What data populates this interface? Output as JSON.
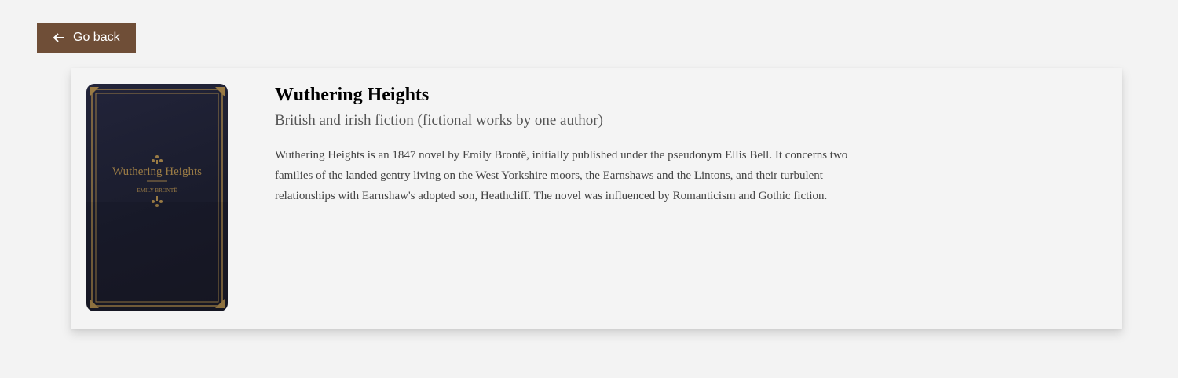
{
  "nav": {
    "back_label": "Go back",
    "back_icon": "arrow-left-icon",
    "accent_color": "#6f4e37"
  },
  "book": {
    "title": "Wuthering Heights",
    "category": "British and irish fiction (fictional works by one author)",
    "description": "Wuthering Heights is an 1847 novel by Emily Brontë, initially published under the pseudonym Ellis Bell. It concerns two families of the landed gentry living on the West Yorkshire moors, the Earnshaws and the Lintons, and their turbulent relationships with Earnshaw's adopted son, Heathcliff. The novel was influenced by Romanticism and Gothic fiction.",
    "cover": {
      "title": "Wuthering Heights",
      "author": "EMILY BRONTË",
      "background_color": "#1c1e2e",
      "ornament_color": "#9a7b45"
    }
  }
}
